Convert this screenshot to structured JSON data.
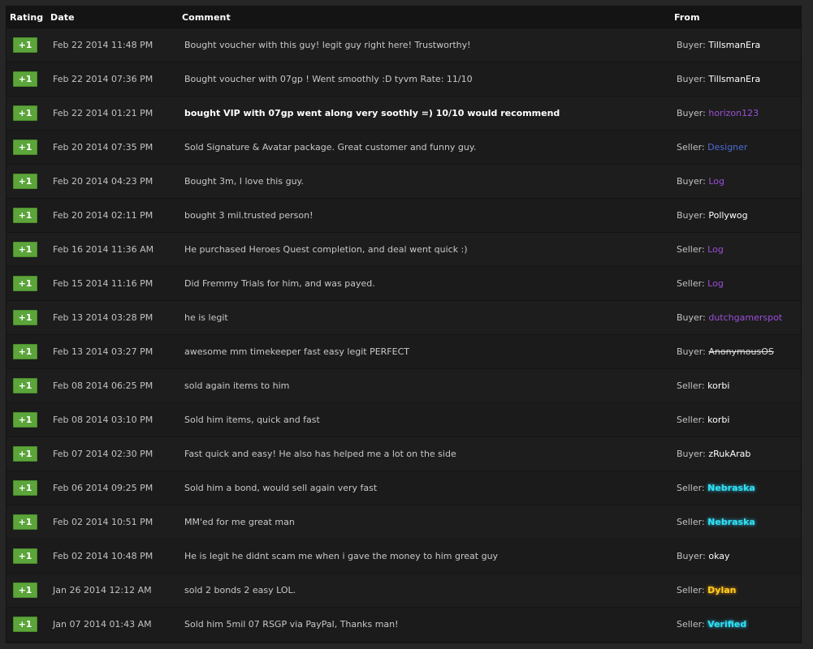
{
  "header": {
    "rating": "Rating",
    "date": "Date",
    "comment": "Comment",
    "from": "From"
  },
  "colors": {
    "badge": "#5ba53a",
    "purple_user": "#9a4fd6",
    "blue_user": "#4f6bd8",
    "cyan_user": "#2fe3f0",
    "gold_user": "#ffd21f"
  },
  "rows": [
    {
      "rating": "+1",
      "date": "Feb 22 2014 11:48 PM",
      "comment": "Bought voucher with this guy! legit guy right here! Trustworthy!",
      "role": "Buyer:",
      "user": "TillsmanEra",
      "style": "white"
    },
    {
      "rating": "+1",
      "date": "Feb 22 2014 07:36 PM",
      "comment": "Bought voucher with 07gp ! Went smoothly :D tyvm Rate: 11/10",
      "role": "Buyer:",
      "user": "TillsmanEra",
      "style": "white"
    },
    {
      "rating": "+1",
      "date": "Feb 22 2014 01:21 PM",
      "comment": "bought VIP with 07gp went along very soothly =) 10/10 would recommend",
      "role": "Buyer:",
      "user": "horizon123",
      "style": "purple",
      "bright": true
    },
    {
      "rating": "+1",
      "date": "Feb 20 2014 07:35 PM",
      "comment": "Sold Signature & Avatar package. Great customer and funny guy.",
      "role": "Seller:",
      "user": "Designer",
      "style": "blue"
    },
    {
      "rating": "+1",
      "date": "Feb 20 2014 04:23 PM",
      "comment": "Bought 3m, I love this guy.",
      "role": "Buyer:",
      "user": "Log",
      "style": "purple"
    },
    {
      "rating": "+1",
      "date": "Feb 20 2014 02:11 PM",
      "comment": "bought 3 mil.trusted person!",
      "role": "Buyer:",
      "user": "Pollywog",
      "style": "white"
    },
    {
      "rating": "+1",
      "date": "Feb 16 2014 11:36 AM",
      "comment": "He purchased Heroes Quest completion, and deal went quick :)",
      "role": "Seller:",
      "user": "Log",
      "style": "purple"
    },
    {
      "rating": "+1",
      "date": "Feb 15 2014 11:16 PM",
      "comment": "Did Fremmy Trials for him, and was payed.",
      "role": "Seller:",
      "user": "Log",
      "style": "purple"
    },
    {
      "rating": "+1",
      "date": "Feb 13 2014 03:28 PM",
      "comment": "he is legit",
      "role": "Buyer:",
      "user": "dutchgamerspot",
      "style": "purple"
    },
    {
      "rating": "+1",
      "date": "Feb 13 2014 03:27 PM",
      "comment": "awesome mm timekeeper fast easy legit PERFECT",
      "role": "Buyer:",
      "user": "AnonymousOS",
      "style": "strike"
    },
    {
      "rating": "+1",
      "date": "Feb 08 2014 06:25 PM",
      "comment": "sold again items to him",
      "role": "Seller:",
      "user": "korbi",
      "style": "white"
    },
    {
      "rating": "+1",
      "date": "Feb 08 2014 03:10 PM",
      "comment": "Sold him items, quick and fast",
      "role": "Seller:",
      "user": "korbi",
      "style": "white"
    },
    {
      "rating": "+1",
      "date": "Feb 07 2014 02:30 PM",
      "comment": "Fast quick and easy! He also has helped me a lot on the side",
      "role": "Buyer:",
      "user": "zRukArab",
      "style": "white"
    },
    {
      "rating": "+1",
      "date": "Feb 06 2014 09:25 PM",
      "comment": "Sold him a bond, would sell again very fast",
      "role": "Seller:",
      "user": "Nebraska",
      "style": "cyan"
    },
    {
      "rating": "+1",
      "date": "Feb 02 2014 10:51 PM",
      "comment": "MM'ed for me great man",
      "role": "Seller:",
      "user": "Nebraska",
      "style": "cyan"
    },
    {
      "rating": "+1",
      "date": "Feb 02 2014 10:48 PM",
      "comment": "He is legit he didnt scam me when i gave the money to him great guy",
      "role": "Buyer:",
      "user": "okay",
      "style": "white"
    },
    {
      "rating": "+1",
      "date": "Jan 26 2014 12:12 AM",
      "comment": "sold 2 bonds 2 easy LOL.",
      "role": "Seller:",
      "user": "Dylan",
      "style": "gold"
    },
    {
      "rating": "+1",
      "date": "Jan 07 2014 01:43 AM",
      "comment": "Sold him 5mil 07 RSGP via PayPal, Thanks man!",
      "role": "Seller:",
      "user": "Verified",
      "style": "cyan"
    }
  ]
}
